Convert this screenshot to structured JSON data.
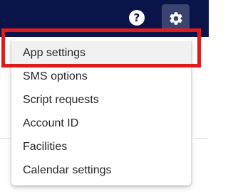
{
  "header": {
    "help_icon": "help-circle-icon",
    "help_glyph": "?",
    "settings_icon": "gear-icon",
    "background_color": "#0a1449",
    "settings_button_color": "#3b4471"
  },
  "menu": {
    "items": [
      {
        "label": "App settings",
        "active": true
      },
      {
        "label": "SMS options"
      },
      {
        "label": "Script requests"
      },
      {
        "label": "Account ID"
      },
      {
        "label": "Facilities"
      },
      {
        "label": "Calendar settings"
      }
    ]
  },
  "annotation": {
    "highlight_color": "#e01b1b"
  }
}
